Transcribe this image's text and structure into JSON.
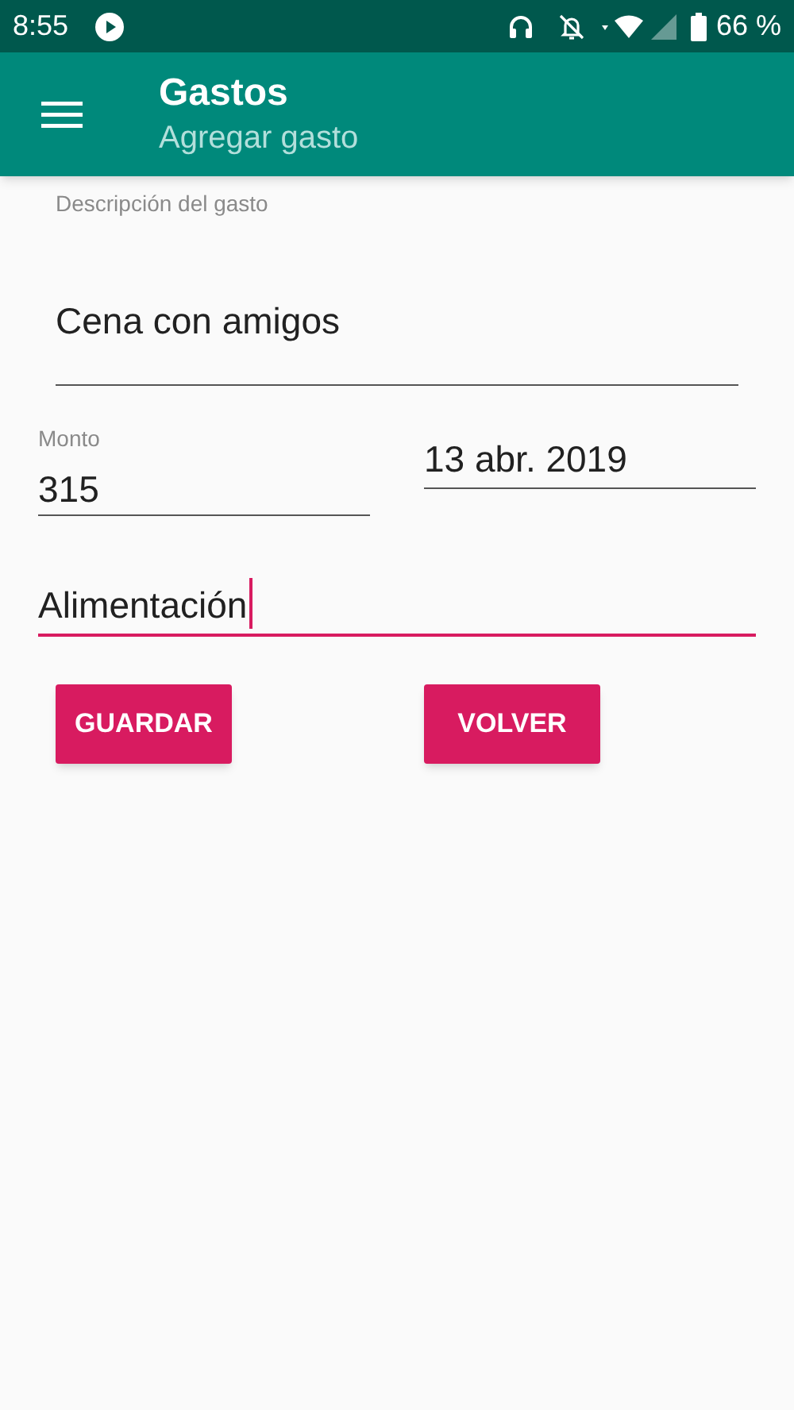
{
  "status_bar": {
    "time": "8:55",
    "battery": "66 %"
  },
  "app_bar": {
    "title": "Gastos",
    "subtitle": "Agregar gasto"
  },
  "fields": [
    {
      "label": "Descripción del gasto",
      "value": "Cena con amigos",
      "focused": false
    },
    {
      "label": "Monto",
      "value": "315",
      "focused": false
    },
    {
      "value": "13 abr. 2019",
      "focused": false
    },
    {
      "value": "Alimentación",
      "focused": true
    }
  ],
  "buttons": [
    {
      "label": "GUARDAR"
    },
    {
      "label": "VOLVER"
    }
  ]
}
